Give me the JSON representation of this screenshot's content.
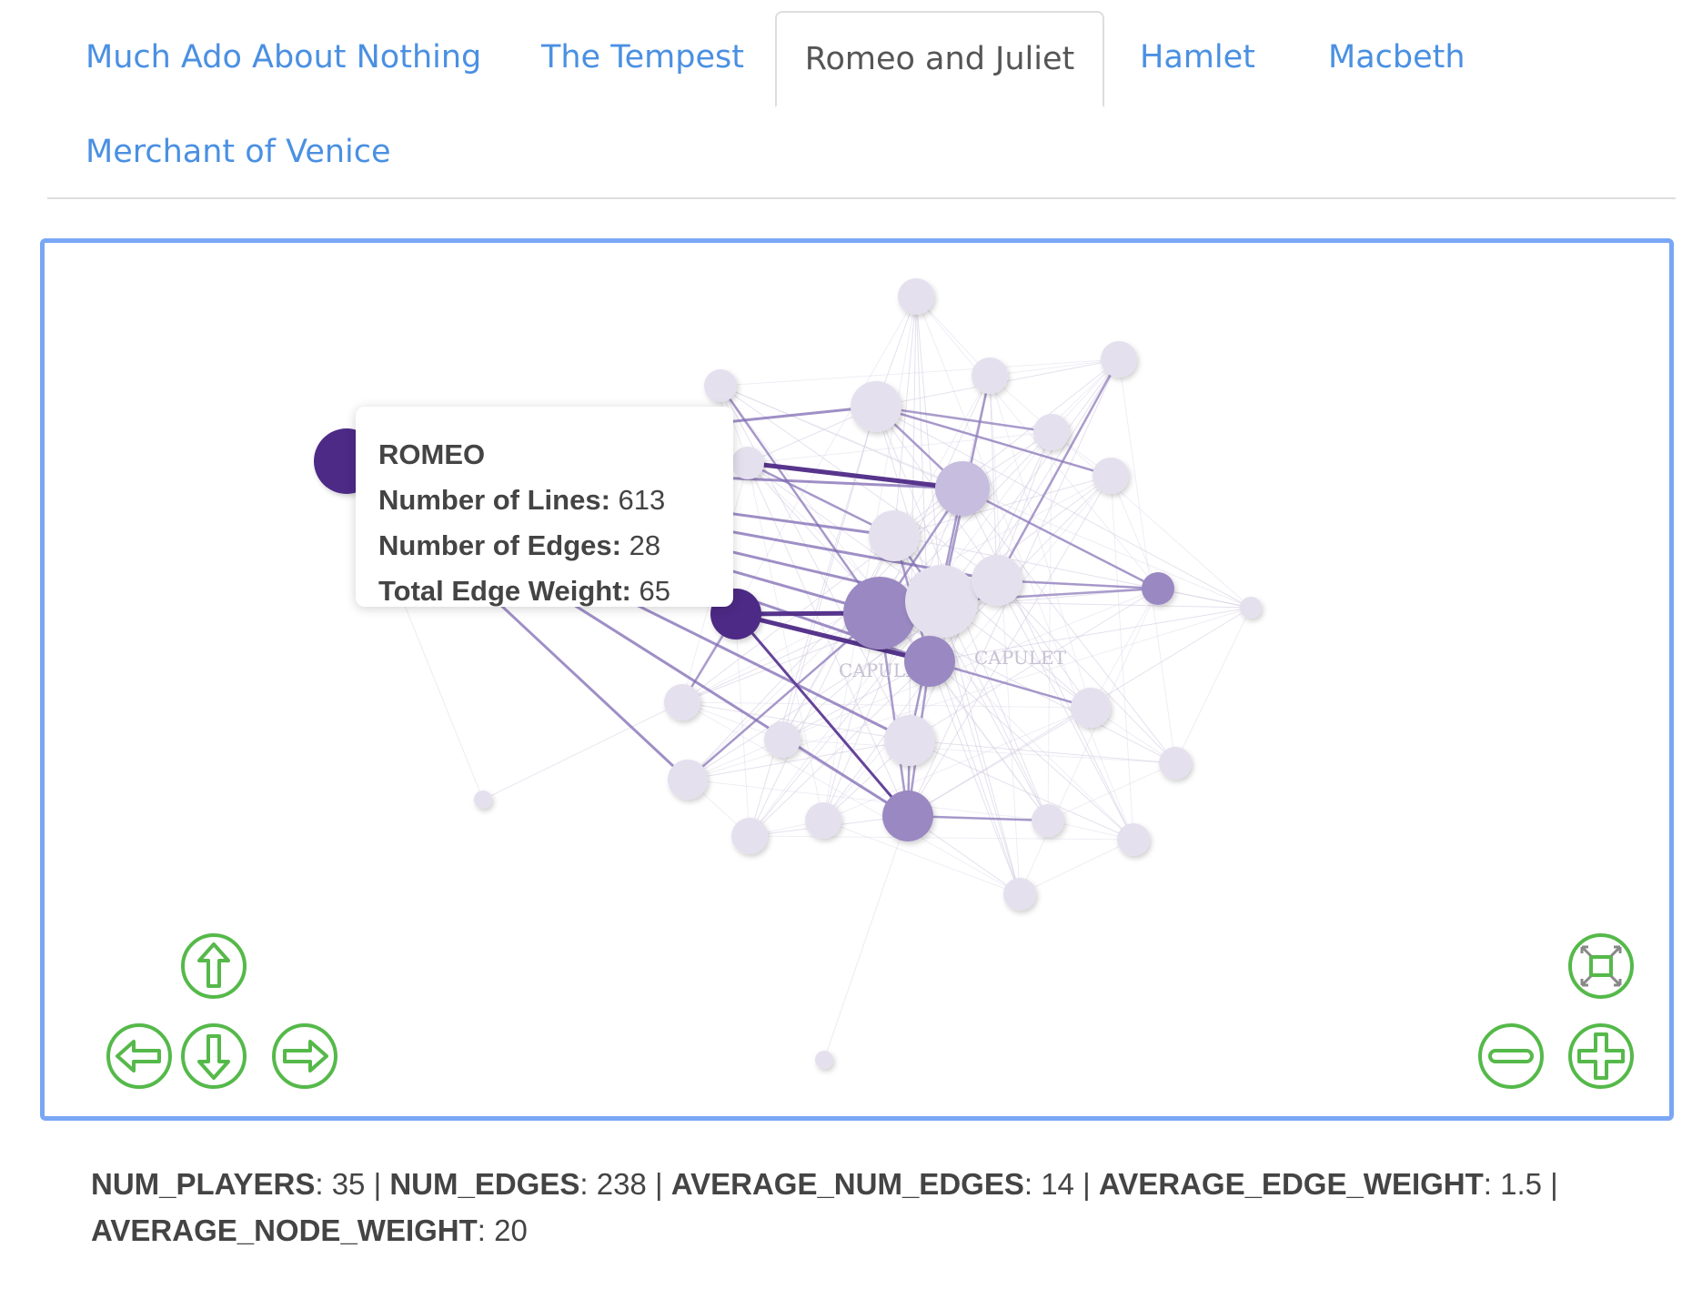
{
  "tabs": [
    {
      "label": "Much Ado About Nothing",
      "active": false
    },
    {
      "label": "The Tempest",
      "active": false
    },
    {
      "label": "Romeo and Juliet",
      "active": true
    },
    {
      "label": "Hamlet",
      "active": false
    },
    {
      "label": "Macbeth",
      "active": false
    },
    {
      "label": "Merchant of Venice",
      "active": false
    }
  ],
  "graph": {
    "node_labels": [
      "CAPULET",
      "CAPULET"
    ],
    "colors": {
      "accent_dark": "#4e2a86",
      "accent_mid": "#9a88c2",
      "node_light": "#e4e0ee",
      "panel_border": "#7aa7f5",
      "control_green": "#55b94a",
      "tab_link": "#4a90e2"
    }
  },
  "tooltip": {
    "name": "ROMEO",
    "lines_label": "Number of Lines:",
    "lines_value": "613",
    "edges_label": "Number of Edges:",
    "edges_value": "28",
    "weight_label": "Total Edge Weight:",
    "weight_value": "65"
  },
  "controls": {
    "pan_up": "arrow-up-icon",
    "pan_left": "arrow-left-icon",
    "pan_down": "arrow-down-icon",
    "pan_right": "arrow-right-icon",
    "fit": "fit-to-screen-icon",
    "zoom_out": "minus-icon",
    "zoom_in": "plus-icon"
  },
  "stats": {
    "num_players_label": "NUM_PLAYERS",
    "num_players": "35",
    "num_edges_label": "NUM_EDGES",
    "num_edges": "238",
    "average_num_edges_label": "AVERAGE_NUM_EDGES",
    "average_num_edges": "14",
    "average_edge_weight_label": "AVERAGE_EDGE_WEIGHT",
    "average_edge_weight": "1.5",
    "average_node_weight_label": "AVERAGE_NODE_WEIGHT",
    "average_node_weight": "20"
  }
}
